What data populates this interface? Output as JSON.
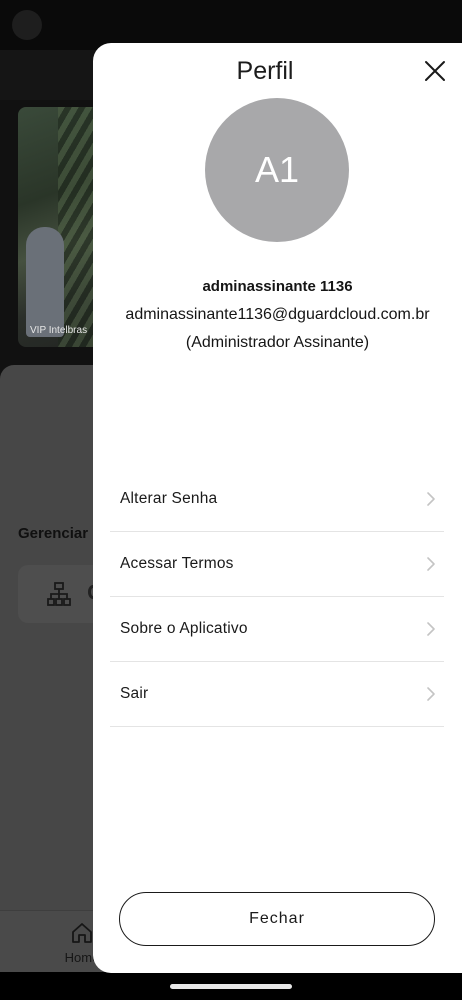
{
  "background": {
    "camera_label": "VIP Intelbras",
    "section_title": "Gerenciar",
    "tab_home_label": "Home",
    "icons": [
      "org-chart-icon",
      "home-icon"
    ]
  },
  "profile": {
    "title": "Perfil",
    "avatar_initials": "A1",
    "name": "adminassinante 1136",
    "email": "adminassinante1136@dguardcloud.com.br",
    "role": "(Administrador Assinante)",
    "menu": [
      {
        "label": "Alterar Senha"
      },
      {
        "label": "Acessar Termos"
      },
      {
        "label": "Sobre o Aplicativo"
      },
      {
        "label": "Sair"
      }
    ],
    "close_label": "Fechar",
    "icons": {
      "close": "close-icon",
      "chevron": "chevron-right-icon"
    }
  },
  "colors": {
    "avatar_bg": "#a8a8aa",
    "sheet_bg": "#ffffff",
    "overlay_bg": "#474747"
  }
}
